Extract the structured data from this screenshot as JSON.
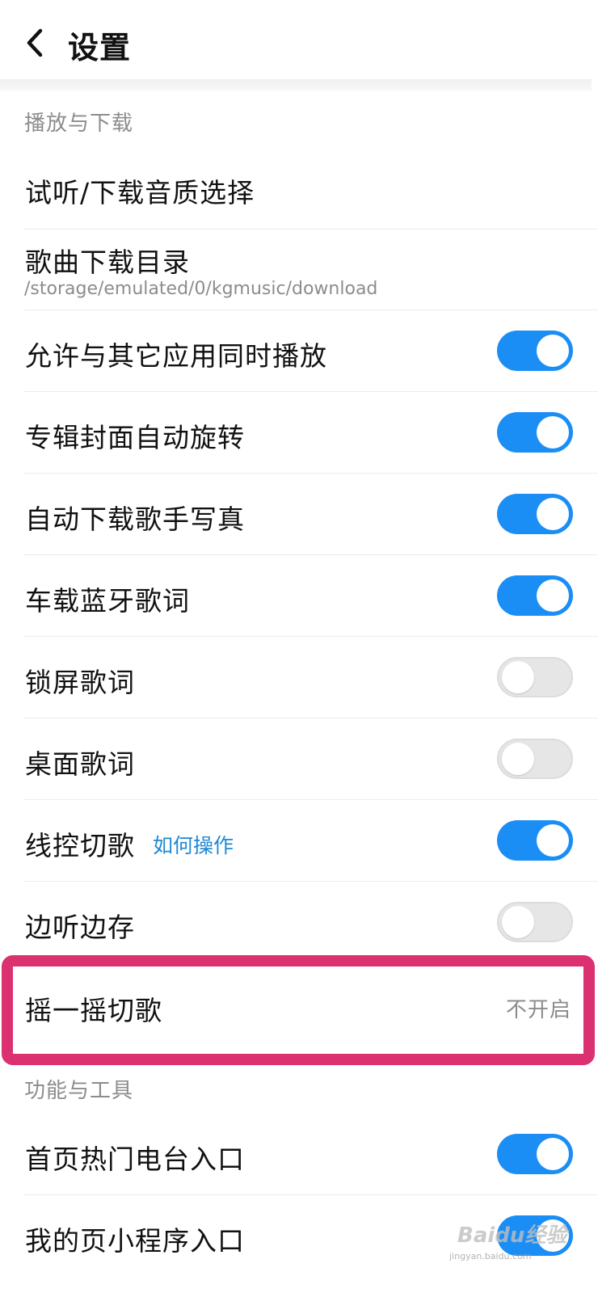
{
  "header": {
    "title": "设置",
    "back_icon": "chevron-left-icon"
  },
  "sections": [
    {
      "title": "播放与下载",
      "rows": [
        {
          "label": "试听/下载音质选择"
        },
        {
          "label": "歌曲下载目录",
          "sub": "/storage/emulated/0/kgmusic/download"
        },
        {
          "label": "允许与其它应用同时播放",
          "toggle": true
        },
        {
          "label": "专辑封面自动旋转",
          "toggle": true
        },
        {
          "label": "自动下载歌手写真",
          "toggle": true
        },
        {
          "label": "车载蓝牙歌词",
          "toggle": true
        },
        {
          "label": "锁屏歌词",
          "toggle": false
        },
        {
          "label": "桌面歌词",
          "toggle": false
        },
        {
          "label": "线控切歌",
          "link": "如何操作",
          "toggle": true
        },
        {
          "label": "边听边存",
          "toggle": false
        },
        {
          "label": "摇一摇切歌",
          "value": "不开启",
          "highlighted": true
        }
      ]
    },
    {
      "title": "功能与工具",
      "rows": [
        {
          "label": "首页热门电台入口",
          "toggle": true
        },
        {
          "label": "我的页小程序入口",
          "toggle": true
        }
      ]
    }
  ],
  "watermark": {
    "text": "Baidu经验",
    "sub": "jingyan.baidu.com"
  },
  "colors": {
    "toggle_on": "#1a8ef5",
    "toggle_off": "#e6e6e6",
    "highlight": "#dc3170",
    "link": "#1e88d6"
  }
}
